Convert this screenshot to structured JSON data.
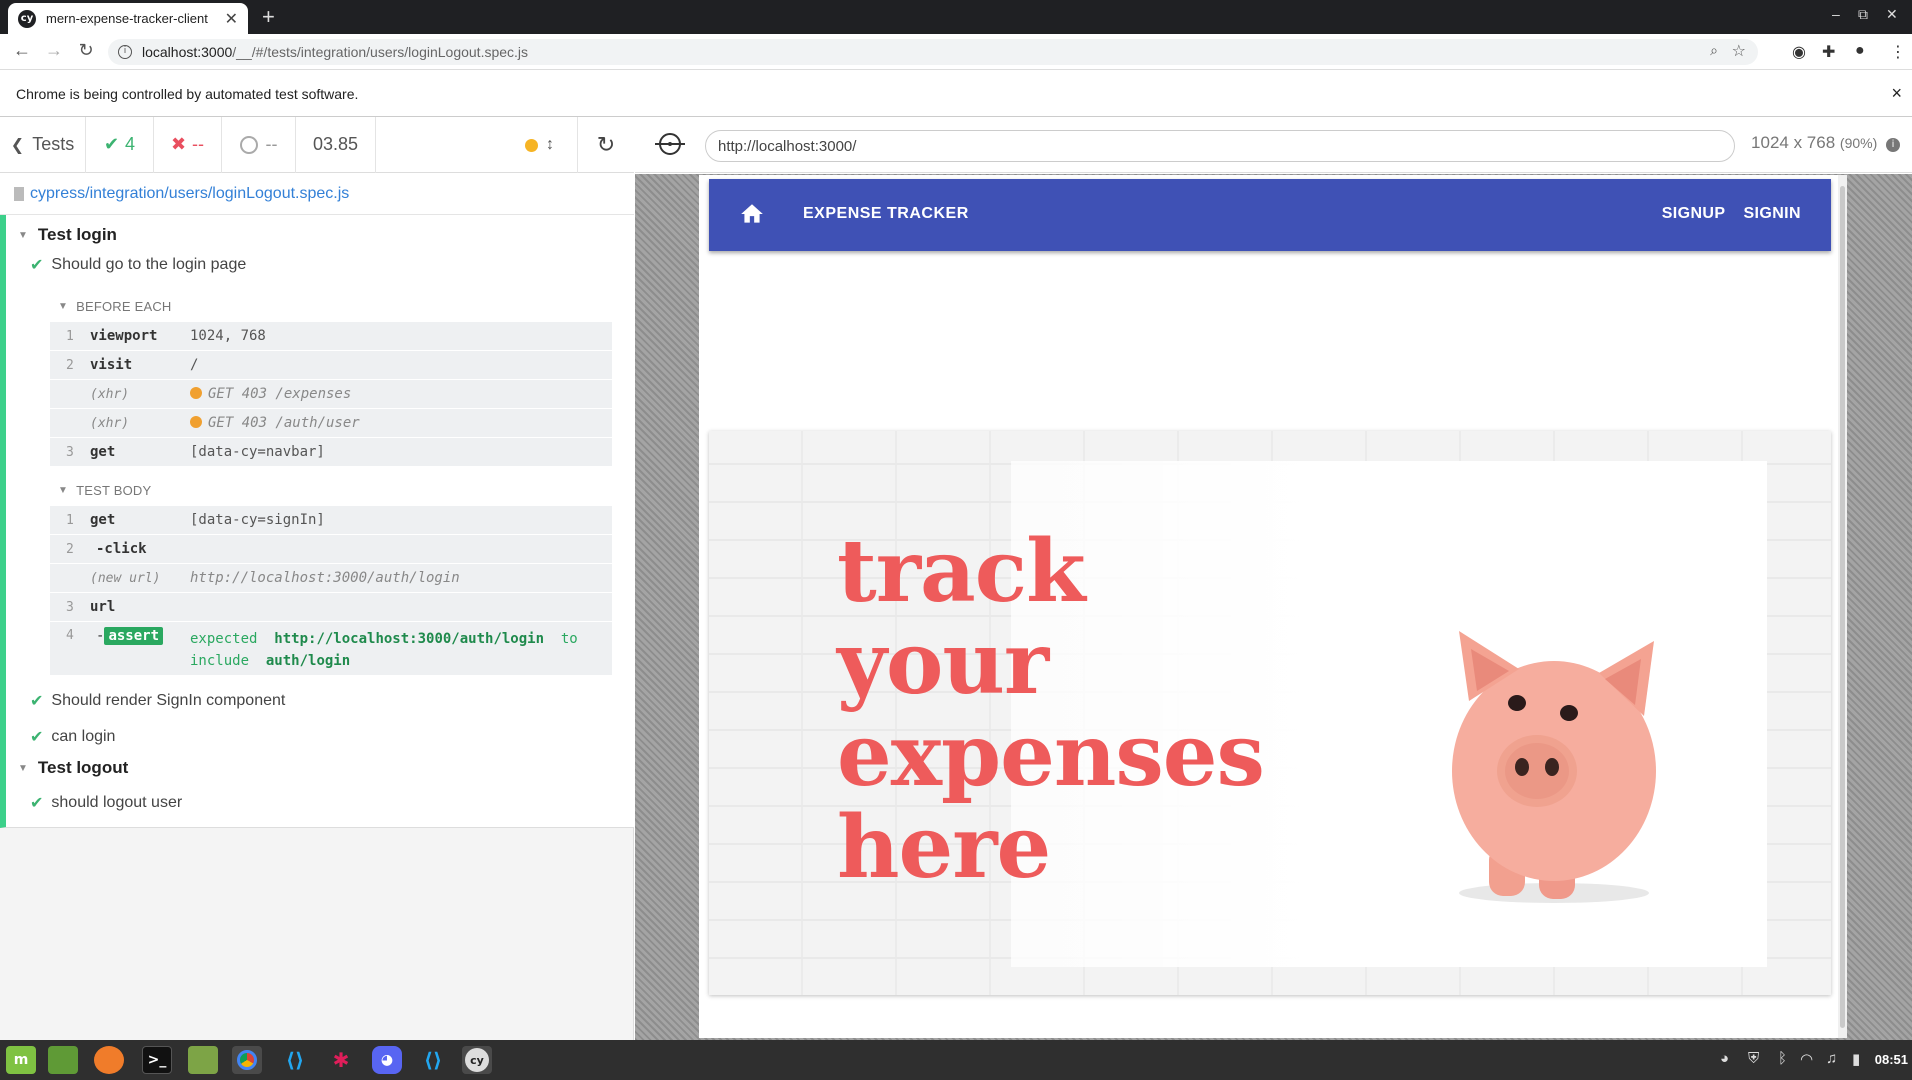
{
  "browser": {
    "tab_title": "mern-expense-tracker-client",
    "tab_favicon": "cy",
    "new_tab": "+",
    "url_host": "localhost:3000",
    "url_rest": "/__/#/tests/integration/users/loginLogout.spec.js",
    "infobar_text": "Chrome is being controlled by automated test software.",
    "infobar_close": "×"
  },
  "reporter": {
    "tests_label": "Tests",
    "passed": "4",
    "failed": "--",
    "pending": "--",
    "duration": "03.85",
    "spec_path": "cypress/integration/users/loginLogout.spec.js",
    "suites": [
      {
        "title": "Test login",
        "tests": [
          {
            "title": "Should go to the login page",
            "hooks": [
              {
                "name": "BEFORE EACH",
                "commands": [
                  {
                    "num": "1",
                    "name": "viewport",
                    "msg": "1024, 768"
                  },
                  {
                    "num": "2",
                    "name": "visit",
                    "msg": "/"
                  },
                  {
                    "num": "",
                    "name": "(xhr)",
                    "msg": "GET 403 /expenses"
                  },
                  {
                    "num": "",
                    "name": "(xhr)",
                    "msg": "GET 403 /auth/user"
                  },
                  {
                    "num": "3",
                    "name": "get",
                    "msg": "[data-cy=navbar]"
                  }
                ]
              },
              {
                "name": "TEST BODY",
                "commands": [
                  {
                    "num": "1",
                    "name": "get",
                    "msg": "[data-cy=signIn]"
                  },
                  {
                    "num": "2",
                    "name": "-click",
                    "msg": ""
                  },
                  {
                    "num": "",
                    "name": "(new url)",
                    "msg": "http://localhost:3000/auth/login"
                  },
                  {
                    "num": "3",
                    "name": "url",
                    "msg": ""
                  },
                  {
                    "num": "4",
                    "name": "assert",
                    "msg_expected": "expected",
                    "msg_value": "http://localhost:3000/auth/login",
                    "msg_to": "to",
                    "msg_include": "include",
                    "msg_target": "auth/login"
                  }
                ]
              }
            ]
          },
          {
            "title": "Should render SignIn component"
          },
          {
            "title": "can login"
          }
        ]
      },
      {
        "title": "Test logout",
        "tests": [
          {
            "title": "should logout user"
          }
        ]
      }
    ]
  },
  "aut": {
    "url": "http://localhost:3000/",
    "viewport": "1024 x 768",
    "scale": "(90%)"
  },
  "app": {
    "brand": "EXPENSE TRACKER",
    "nav": [
      "SIGNUP",
      "SIGNIN"
    ],
    "hero_lines": [
      "track",
      "your",
      "expenses",
      "here"
    ],
    "primary_color": "#3f51b5",
    "hero_text_color": "#ee5b5b"
  },
  "system": {
    "clock": "08:51"
  },
  "colors": {
    "pass": "#3cb371",
    "fail": "#e94f5f",
    "running": "#f6b425",
    "link": "#3380d7"
  }
}
